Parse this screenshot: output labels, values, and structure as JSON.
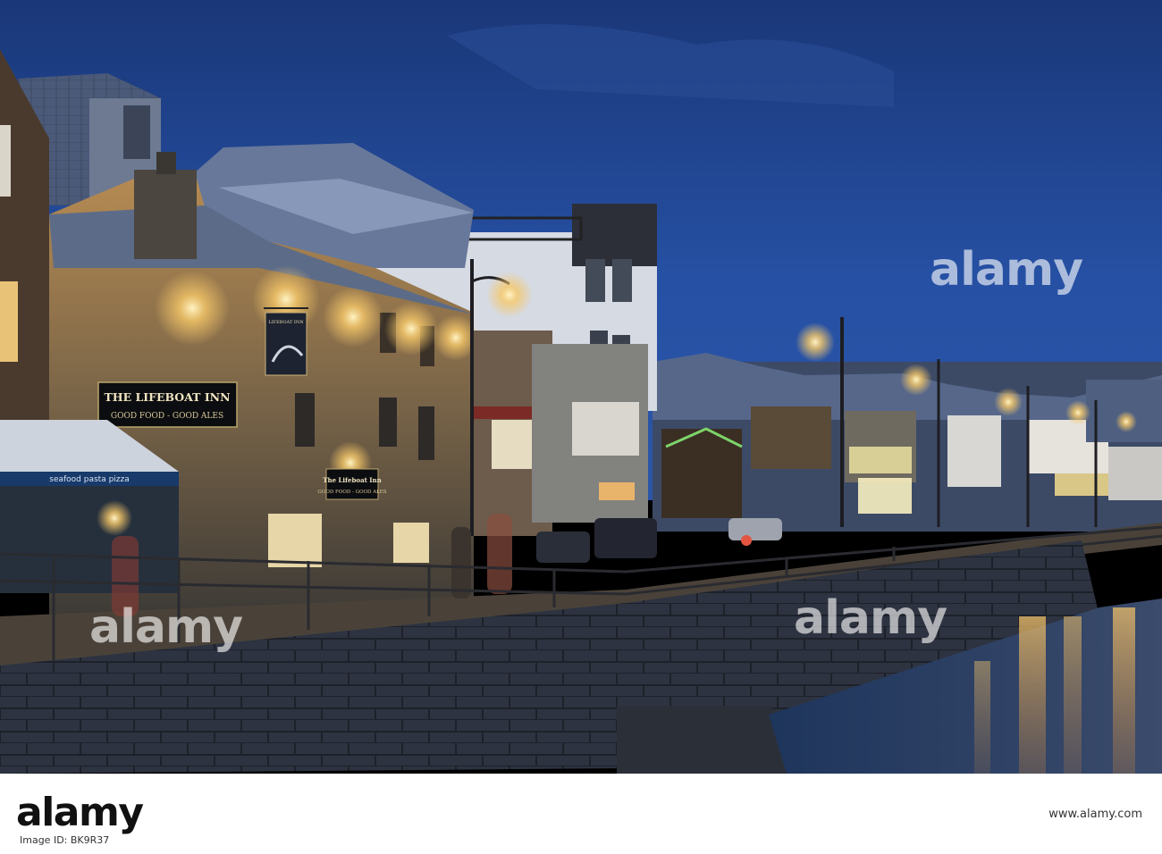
{
  "scene": {
    "pub_sign_title": "THE LIFEBOAT INN",
    "pub_sign_subtitle": "GOOD FOOD - GOOD ALES",
    "small_sign_title": "The Lifeboat Inn",
    "small_sign_subtitle": "GOOD FOOD - GOOD ALES",
    "awning_text": "seafood  pasta  pizza",
    "hanging_sign_text": "LIFEBOAT INN"
  },
  "watermarks": [
    "alamy",
    "alamy",
    "alamy"
  ],
  "footer": {
    "logo": "alamy",
    "stock_photo_id": "Image ID: BK9R37",
    "url": "www.alamy.com"
  },
  "colors": {
    "sky": "#1d3f83",
    "lamp_glow": "#f6c869",
    "water": "#16335f",
    "wall": "#2a2f3a"
  }
}
